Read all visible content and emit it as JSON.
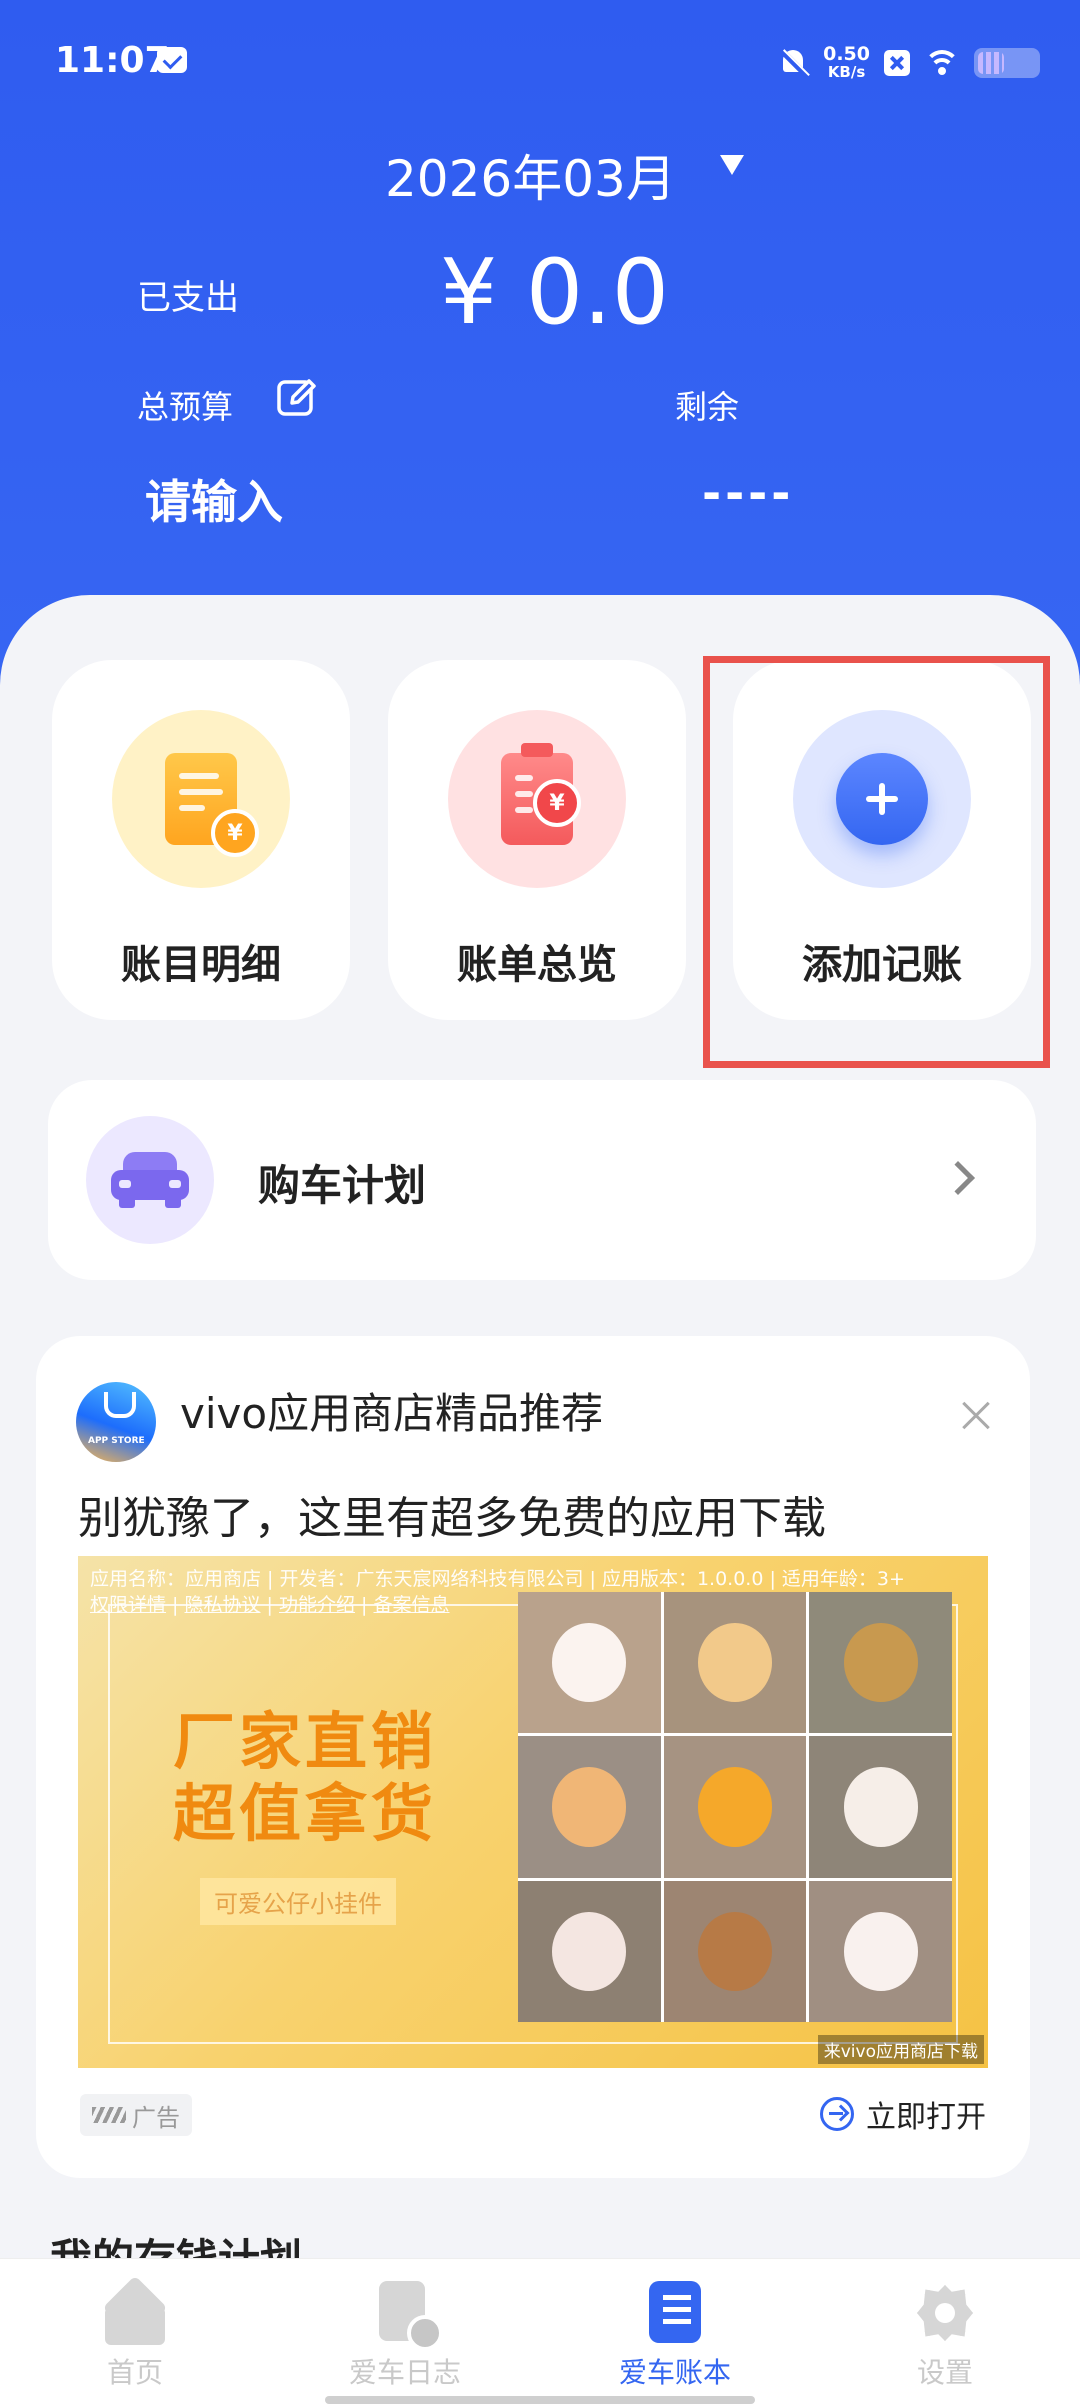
{
  "status_bar": {
    "time": "11:07",
    "net_speed_value": "0.50",
    "net_speed_unit": "KB/s"
  },
  "header": {
    "month": "2026年03月",
    "spent_label": "已支出",
    "spent_value": "¥ 0.0",
    "budget_label": "总预算",
    "budget_placeholder": "请输入",
    "remain_label": "剩余",
    "remain_value": "----"
  },
  "tiles": [
    {
      "label": "账目明细",
      "icon": "ledger-detail-icon"
    },
    {
      "label": "账单总览",
      "icon": "bill-overview-icon"
    },
    {
      "label": "添加记账",
      "icon": "add-icon"
    }
  ],
  "car_plan": {
    "label": "购车计划"
  },
  "ad": {
    "title": "vivo应用商店精品推荐",
    "subtitle": "别犹豫了，这里有超多免费的应用下载",
    "logo_text": "APP STORE",
    "banner_info": "应用名称：应用商店 | 开发者：广东天宸网络科技有限公司 | 应用版本：1.0.0.0 | 适用年龄：3+",
    "banner_links": [
      "权限详情",
      "隐私协议",
      "功能介绍",
      "备案信息"
    ],
    "headline_1": "厂家直销",
    "headline_2": "超值拿货",
    "tag": "可爱公仔小挂件",
    "source": "来vivo应用商店下载",
    "badge": "广告",
    "open_label": "立即打开"
  },
  "section_peek": "我的存钱计划",
  "bottom_nav": [
    {
      "label": "首页",
      "icon": "home-icon"
    },
    {
      "label": "爱车日志",
      "icon": "car-log-icon"
    },
    {
      "label": "爱车账本",
      "icon": "car-ledger-icon"
    },
    {
      "label": "设置",
      "icon": "settings-icon"
    }
  ],
  "colors": {
    "header_blue": "#2f5cf0",
    "accent_blue": "#3466f1",
    "highlight_red": "#e9524c"
  }
}
